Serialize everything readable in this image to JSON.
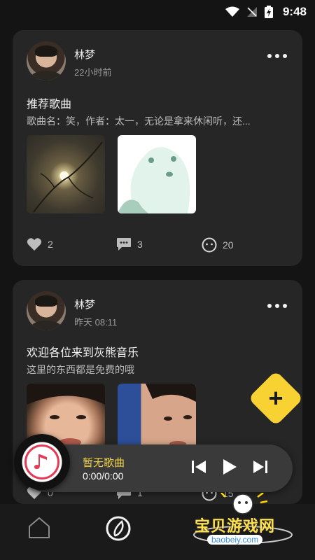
{
  "status_bar": {
    "time": "9:48"
  },
  "posts": [
    {
      "user_name": "林梦",
      "time": "22小时前",
      "title": "推荐歌曲",
      "description": "歌曲名：笑，作者：太一，无论是拿来休闲听，还...",
      "likes": "2",
      "comments": "3",
      "views": "20"
    },
    {
      "user_name": "林梦",
      "time": "昨天 08:11",
      "title": "欢迎各位来到灰熊音乐",
      "description": "这里的东西都是免费的哦",
      "likes": "0",
      "comments": "1",
      "views": "15"
    }
  ],
  "player": {
    "song_title": "暂无歌曲",
    "time": "0:00/0:00"
  },
  "watermark": {
    "text": "宝贝游戏网",
    "url": "baobeiy.com"
  },
  "colors": {
    "accent": "#f7d232",
    "background": "#141414",
    "card": "#262626",
    "disc_ring": "#e43a56"
  }
}
